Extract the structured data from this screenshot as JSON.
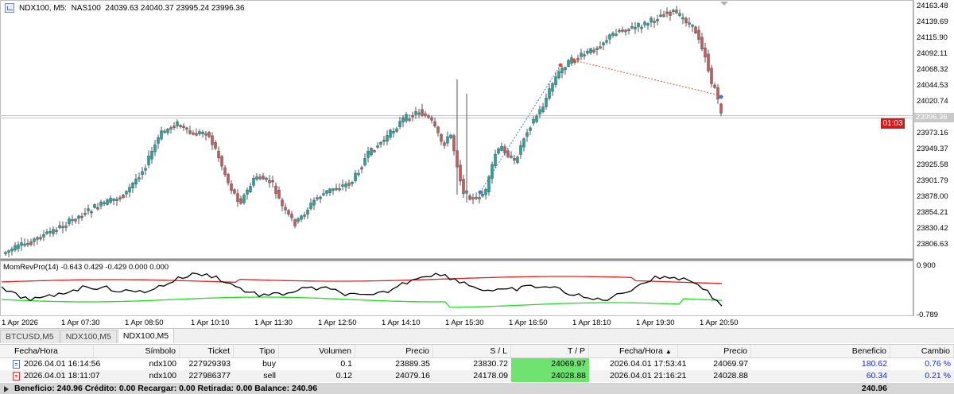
{
  "header": {
    "icon": "chart-window-icon",
    "symbol_info": "NDX100, M5:  NAS100  24039.63 24040.37 23995.24 23996.36"
  },
  "price_axis": {
    "labels": [
      "24163.48",
      "24139.69",
      "24115.90",
      "24092.11",
      "24068.32",
      "24044.53",
      "24020.74",
      "23996.36",
      "23973.16",
      "23949.37",
      "23925.58",
      "23901.79",
      "23878.00",
      "23854.21",
      "23830.42",
      "23806.63"
    ],
    "current_price": "23996.36",
    "timer": "01:03",
    "indicator_max": "0.900",
    "indicator_min": "-0.789"
  },
  "time_axis": {
    "labels": [
      "1 Apr 2026",
      "1 Apr 07:30",
      "1 Apr 08:50",
      "1 Apr 10:10",
      "1 Apr 11:30",
      "1 Apr 12:50",
      "1 Apr 14:10",
      "1 Apr 15:30",
      "1 Apr 16:50",
      "1 Apr 18:10",
      "1 Apr 19:30",
      "1 Apr 20:50"
    ]
  },
  "indicator": {
    "label": "MomRevPro(14) -0.643 0.429 -0.429 0.000 0.000"
  },
  "colors": {
    "bull": "#19a7a7",
    "bear": "#c85a5a",
    "upper_band": "#e02020",
    "lower_band": "#22dd22",
    "osc_line": "#000000",
    "tp_highlight": "#6fe36f",
    "profit_blue": "#1a28d6",
    "timer_bg": "#d21a1a"
  },
  "tabs": [
    {
      "label": "BTCUSD,M5",
      "active": false
    },
    {
      "label": "NDX100,M5",
      "active": false
    },
    {
      "label": "NDX100,M5",
      "active": true
    }
  ],
  "table": {
    "columns": [
      "Fecha/Hora",
      "Símbolo",
      "Ticket",
      "Tipo",
      "Volumen",
      "Precio",
      "S / L",
      "T / P",
      "Fecha/Hora",
      "Precio",
      "Beneficio",
      "Cambio"
    ],
    "sort_indicator": "▲",
    "rows": [
      {
        "icon": "buy-order-icon",
        "open_time": "2026.04.01 16:14:56",
        "symbol": "ndx100",
        "ticket": "227929393",
        "type": "buy",
        "volume": "0.1",
        "open_price": "23889.35",
        "sl": "23830.72",
        "tp": "24069.97",
        "close_time": "2026.04.01 17:53:41",
        "close_price": "24069.97",
        "profit": "180.62",
        "change": "0.76 %"
      },
      {
        "icon": "sell-order-icon",
        "open_time": "2026.04.01 18:11:07",
        "symbol": "ndx100",
        "ticket": "227986377",
        "type": "sell",
        "volume": "0.12",
        "open_price": "24079.16",
        "sl": "24178.09",
        "tp": "24028.88",
        "close_time": "2026.04.01 21:16:21",
        "close_price": "24028.88",
        "profit": "60.34",
        "change": "0.21 %"
      }
    ],
    "summary": {
      "text": "Beneficio: 240.96  Crédito: 0.00  Recargar: 0.00  Retirada: 0.00  Balance: 240.96",
      "total": "240.96"
    }
  }
}
